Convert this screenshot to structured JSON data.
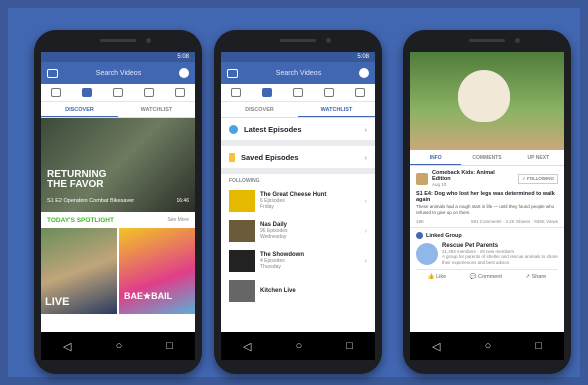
{
  "common": {
    "status_time": "5:08",
    "search_placeholder": "Search Videos",
    "tab_discover": "DISCOVER",
    "tab_watchlist": "WATCHLIST",
    "nav_back": "◁",
    "nav_home": "○",
    "nav_recent": "□"
  },
  "phone1": {
    "hero_title": "RETURNING THE FAVOR",
    "hero_subtitle": "S1 E2 Operation Combat Bikesaver",
    "hero_duration": "16:46",
    "spotlight_heading": "TODAY'S SPOTLIGHT",
    "spotlight_more": "See More",
    "thumb1_label": "LIVE",
    "thumb2_label": "BAE★BAIL"
  },
  "phone2": {
    "latest_episodes": "Latest Episodes",
    "saved_episodes": "Saved Episodes",
    "following_heading": "FOLLOWING",
    "shows": [
      {
        "title": "The Great Cheese Hunt",
        "episodes": "6 Episodes",
        "day": "Friday"
      },
      {
        "title": "Nas Daily",
        "episodes": "96 Episodes",
        "day": "Wednesday"
      },
      {
        "title": "The Showdown",
        "episodes": "4 Episodes",
        "day": "Thursday"
      },
      {
        "title": "Kitchen Live",
        "episodes": "",
        "day": ""
      }
    ]
  },
  "phone3": {
    "tab_info": "INFO",
    "tab_comments": "COMMENTS",
    "tab_upnext": "UP NEXT",
    "page_name": "Comeback Kids: Animal Edition",
    "page_date": "Aug 10",
    "follow_button": "✓ FOLLOWING",
    "episode_title": "S1 E4: Dog who lost her legs was determined to walk again",
    "episode_desc": "These animals had a rough start in life — until they found people who refused to give up on them.",
    "reactions": "19K",
    "stats": "591 Comments · 4.2K Shares · 936K Views",
    "linked_group_label": "Linked Group",
    "group_name": "Rescue Pet Parents",
    "group_members": "21,493 members · 29 new members",
    "group_desc": "A group for parents of shelter and rescue animals to share their experiences and best advice.",
    "action_like": "Like",
    "action_comment": "Comment",
    "action_share": "Share"
  }
}
